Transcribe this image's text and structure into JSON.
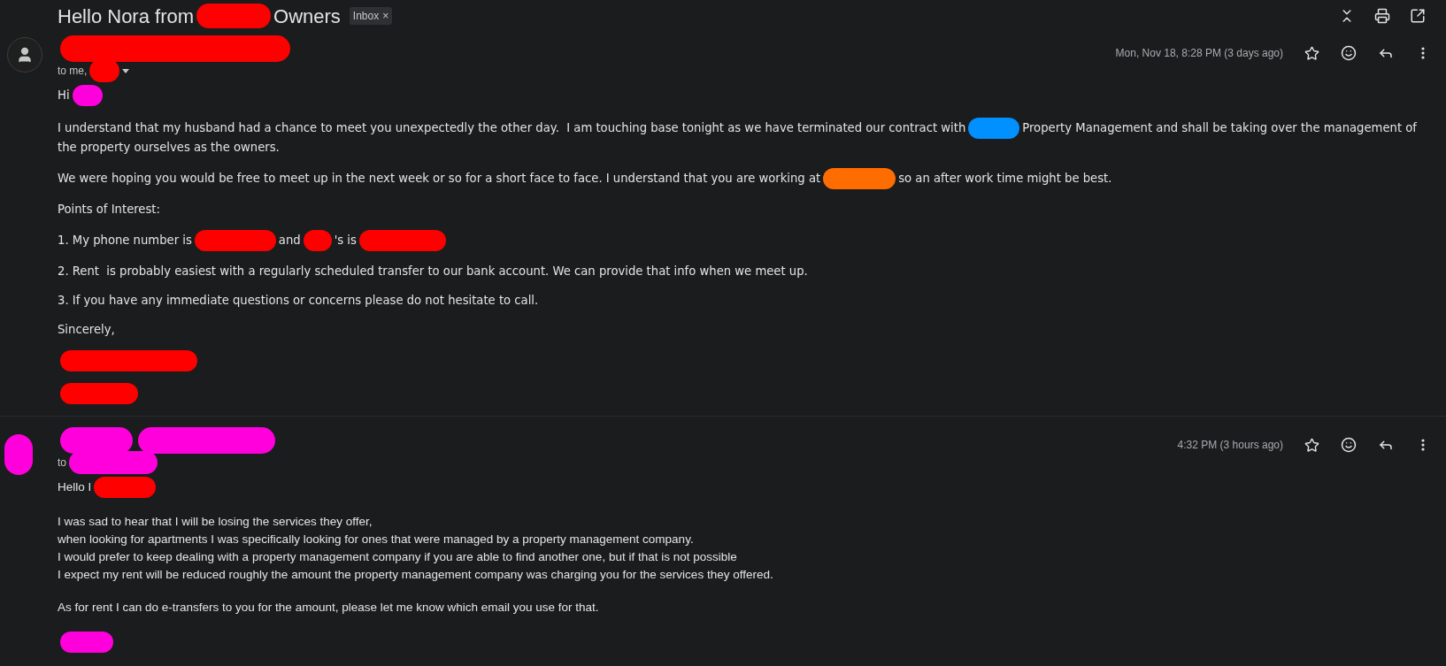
{
  "subject": {
    "parts": [
      {
        "kind": "text",
        "text": "Hello Nora from"
      },
      {
        "kind": "redaction",
        "color": "#ff0000"
      },
      {
        "kind": "text",
        "text": "Owners"
      }
    ],
    "label": "Inbox",
    "label_remove": "×"
  },
  "messages": [
    {
      "avatar": {
        "kind": "icon"
      },
      "sender": [
        {
          "kind": "redaction",
          "color": "#ff0000"
        }
      ],
      "recipients": [
        {
          "kind": "text",
          "text": "to me,"
        },
        {
          "kind": "redaction",
          "color": "#ff0000"
        }
      ],
      "show_details": true,
      "time": "Mon, Nov 18, 8:28 PM (3 days ago)",
      "body": [
        {
          "lines": [
            {
              "parts": [
                {
                  "kind": "text",
                  "text": "Hi"
                },
                {
                  "kind": "redaction",
                  "color": "#ff00dd"
                }
              ]
            }
          ]
        },
        {
          "lines": [
            {
              "parts": [
                {
                  "kind": "text",
                  "text": "I understand that my husband had a chance to meet you unexpectedly the other day.  I am touching base tonight as we have terminated our contract with"
                },
                {
                  "kind": "redaction",
                  "color": "#0090ff"
                },
                {
                  "kind": "text",
                  "text": "Property Management and shall be taking over the management of"
                }
              ]
            },
            {
              "parts": [
                {
                  "kind": "text",
                  "text": "the property ourselves as the owners."
                }
              ]
            }
          ]
        },
        {
          "lines": [
            {
              "parts": [
                {
                  "kind": "text",
                  "text": "We were hoping you would be free to meet up in the next week or so for a short face to face. I understand that you are working at"
                },
                {
                  "kind": "redaction",
                  "color": "#ff6d00"
                },
                {
                  "kind": "text",
                  "text": "so an after work time might be best."
                }
              ]
            }
          ]
        },
        {
          "lines": [
            {
              "parts": [
                {
                  "kind": "text",
                  "text": "Points of Interest:"
                }
              ]
            }
          ]
        },
        {
          "lines": [
            {
              "parts": [
                {
                  "kind": "text",
                  "text": "1. My phone number is"
                },
                {
                  "kind": "redaction",
                  "color": "#ff0000"
                },
                {
                  "kind": "text",
                  "text": "and"
                },
                {
                  "kind": "redaction",
                  "color": "#ff0000"
                },
                {
                  "kind": "text",
                  "text": "'s is"
                },
                {
                  "kind": "redaction",
                  "color": "#ff0000"
                }
              ]
            }
          ]
        },
        {
          "lines": [
            {
              "parts": [
                {
                  "kind": "text",
                  "text": "2. Rent  is probably easiest with a regularly scheduled transfer to our bank account. We can provide that info when we meet up."
                }
              ]
            }
          ]
        },
        {
          "lines": [
            {
              "parts": [
                {
                  "kind": "text",
                  "text": "3. If you have any immediate questions or concerns please do not hesitate to call."
                }
              ]
            }
          ]
        },
        {
          "lines": [
            {
              "parts": [
                {
                  "kind": "text",
                  "text": "Sincerely,"
                }
              ]
            }
          ]
        },
        {
          "lines": [
            {
              "parts": [
                {
                  "kind": "redaction",
                  "color": "#ff0000"
                }
              ]
            }
          ]
        },
        {
          "lines": [
            {
              "parts": [
                {
                  "kind": "redaction",
                  "color": "#ff0000"
                }
              ]
            }
          ]
        }
      ]
    },
    {
      "avatar": {
        "kind": "redaction",
        "color": "#ff00dd"
      },
      "sender": [
        {
          "kind": "redaction",
          "color": "#ff00dd"
        },
        {
          "kind": "redaction",
          "color": "#ff00dd"
        }
      ],
      "recipients": [
        {
          "kind": "text",
          "text": "to"
        },
        {
          "kind": "redaction",
          "color": "#ff00dd"
        }
      ],
      "show_details": false,
      "time": "4:32 PM (3 hours ago)",
      "body": [
        {
          "lines": [
            {
              "parts": [
                {
                  "kind": "text",
                  "text": "Hello I"
                },
                {
                  "kind": "redaction",
                  "color": "#ff0000"
                }
              ]
            }
          ]
        },
        {
          "lines": [
            {
              "parts": [
                {
                  "kind": "text",
                  "text": "I was sad to hear that I will be losing the services they offer,"
                }
              ]
            },
            {
              "parts": [
                {
                  "kind": "text",
                  "text": "when looking for apartments I was specifically looking for ones that were managed by a property management company."
                }
              ]
            },
            {
              "parts": [
                {
                  "kind": "text",
                  "text": "I would prefer to keep dealing with a property management company if you are able to find another one, but if that is not possible"
                }
              ]
            },
            {
              "parts": [
                {
                  "kind": "text",
                  "text": "I expect my rent will be reduced roughly the amount the property management company was charging you for the services they offered."
                }
              ]
            }
          ]
        },
        {
          "lines": [
            {
              "parts": [
                {
                  "kind": "text",
                  "text": "As for rent I can do e-transfers to you for the amount, please let me know which email you use for that."
                }
              ]
            }
          ]
        },
        {
          "lines": [
            {
              "parts": [
                {
                  "kind": "redaction",
                  "color": "#ff00dd"
                }
              ]
            }
          ]
        }
      ]
    }
  ]
}
